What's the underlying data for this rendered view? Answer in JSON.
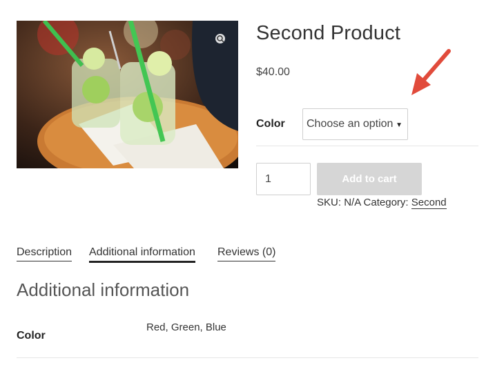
{
  "product": {
    "title": "Second Product",
    "price": "$40.00",
    "color_label": "Color",
    "color_select": {
      "selected": "Choose an option"
    },
    "quantity": "1",
    "add_to_cart_label": "Add to cart",
    "meta": {
      "sku_label": "SKU:",
      "sku_value": "N/A",
      "category_label": "Category:",
      "category_value": "Second"
    }
  },
  "tabs": [
    {
      "label": "Description",
      "active": false
    },
    {
      "label": "Additional information",
      "active": true
    },
    {
      "label": "Reviews (0)",
      "active": false
    }
  ],
  "additional_info": {
    "heading": "Additional information",
    "rows": [
      {
        "label": "Color",
        "value": "Red, Green, Blue"
      }
    ]
  },
  "colors": {
    "arrow": "#e14b3b",
    "button_disabled": "#d6d6d6"
  },
  "icons": {
    "zoom": "magnifier-icon",
    "arrow": "annotation-arrow-icon"
  }
}
